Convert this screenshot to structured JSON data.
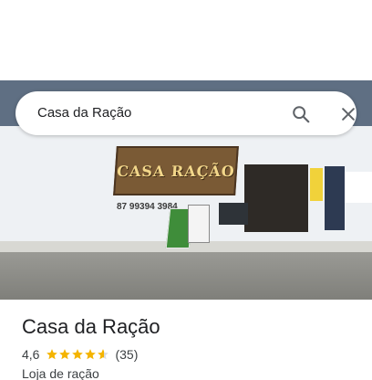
{
  "search": {
    "query": "Casa da Ração"
  },
  "photo": {
    "sign_text": "CASA RAÇÃO",
    "phone_text": "87 99394 3984"
  },
  "place": {
    "name": "Casa da Ração",
    "rating": "4,6",
    "rating_value": 4.6,
    "review_count": "(35)",
    "category": "Loja de ração"
  },
  "colors": {
    "star": "#f4b400",
    "star_empty": "#dadce0",
    "text_primary": "#202124",
    "text_secondary": "#3c4043"
  },
  "icons": {
    "search": "search-icon",
    "close": "close-icon",
    "star": "star-icon"
  }
}
